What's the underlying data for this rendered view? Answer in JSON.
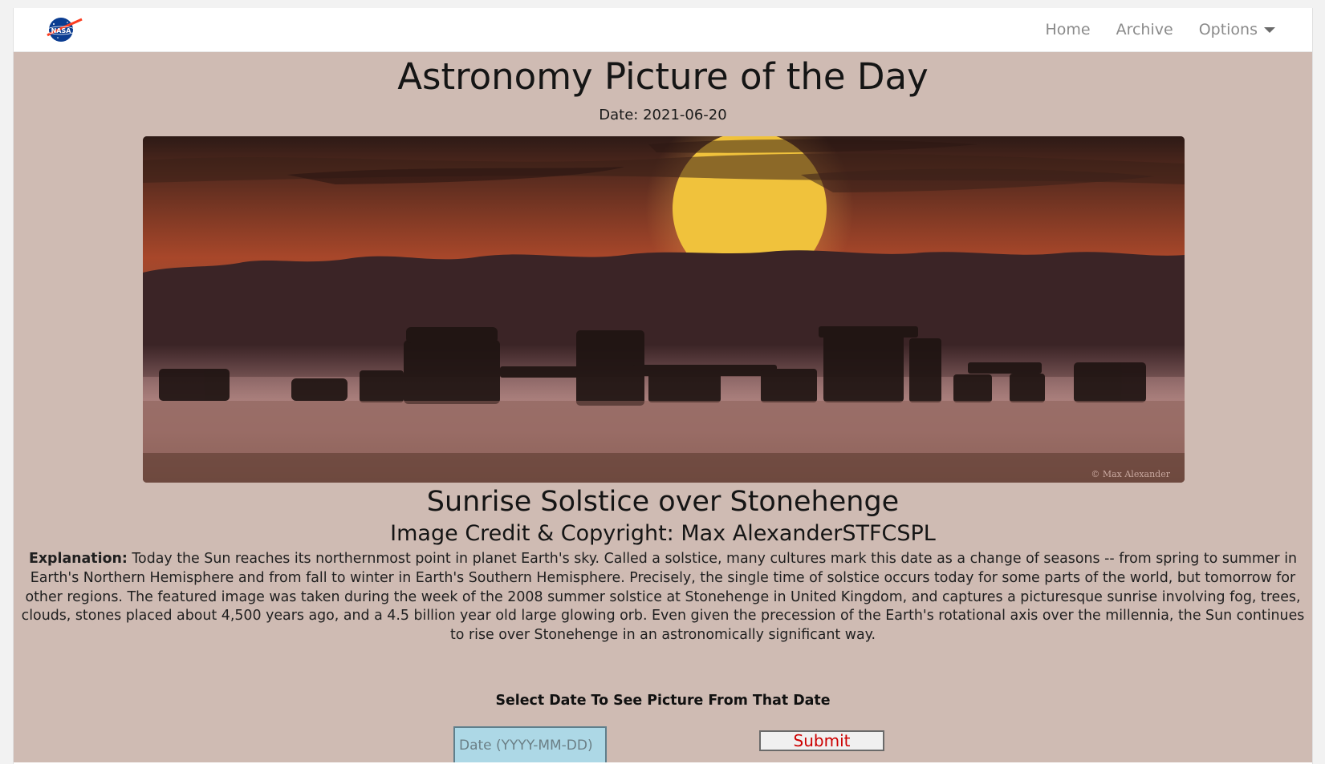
{
  "nav": {
    "logo_text": "NASA",
    "links": [
      "Home",
      "Archive",
      "Options"
    ]
  },
  "page": {
    "title": "Astronomy Picture of the Day",
    "date": "Date: 2021-06-20"
  },
  "picture": {
    "watermark": "© Max Alexander",
    "title": "Sunrise Solstice over Stonehenge",
    "credit": "Image Credit & Copyright: Max AlexanderSTFCSPL",
    "explanation_label": "Explanation:",
    "explanation_text": " Today the Sun reaches its northernmost point in planet Earth's sky. Called a solstice, many cultures mark this date as a change of seasons -- from spring to summer in Earth's Northern Hemisphere and from fall to winter in Earth's Southern Hemisphere. Precisely, the single time of solstice occurs today for some parts of the world, but tomorrow for other regions. The featured image was taken during the week of the 2008 summer solstice at Stonehenge in United Kingdom, and captures a picturesque sunrise involving fog, trees, clouds, stones placed about 4,500 years ago, and a 4.5 billion year old large glowing orb. Even given the precession of the Earth's rotational axis over the millennia, the Sun continues to rise over Stonehenge in an astronomically significant way."
  },
  "form": {
    "label": "Select Date To See Picture From That Date",
    "placeholder": "Date (YYYY-MM-DD)",
    "submit_label": "Submit"
  },
  "colors": {
    "content_bg": "#cfbbb3",
    "input_bg": "#add8e6",
    "submit_text": "#cc0000",
    "nav_text": "#8a8a8a"
  }
}
